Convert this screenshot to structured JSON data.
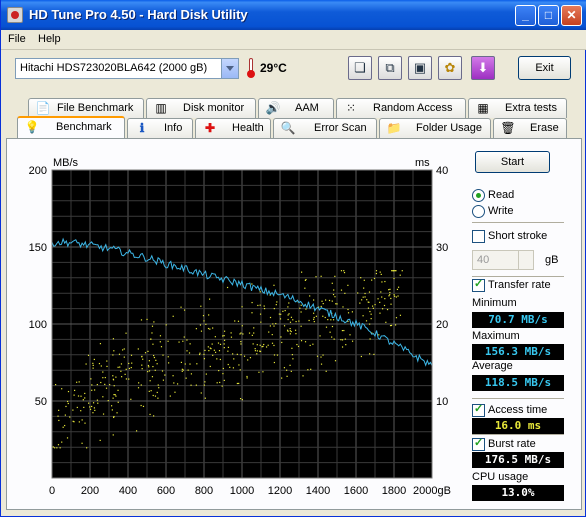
{
  "window": {
    "title": "HD Tune Pro 4.50 - Hard Disk Utility"
  },
  "titlebar_buttons": {
    "minimize": "_",
    "maximize": "□",
    "close": "✕"
  },
  "menu": {
    "file": "File",
    "help": "Help"
  },
  "toolbar": {
    "drive": "Hitachi HDS723020BLA642 (2000 gB)",
    "temperature": "29°C",
    "exit_label": "Exit",
    "icons": [
      "copy-text-icon",
      "copy-screen-icon",
      "save-icon",
      "options-icon",
      "download-icon"
    ]
  },
  "tabs_top": [
    "File Benchmark",
    "Disk monitor",
    "AAM",
    "Random Access",
    "Extra tests"
  ],
  "tabs_bottom": [
    "Benchmark",
    "Info",
    "Health",
    "Error Scan",
    "Folder Usage",
    "Erase"
  ],
  "active_tab": "Benchmark",
  "controls": {
    "start_label": "Start",
    "read_label": "Read",
    "write_label": "Write",
    "mode": "Read",
    "short_stroke_label": "Short stroke",
    "short_stroke_checked": false,
    "short_stroke_value": "40",
    "short_stroke_unit": "gB",
    "transfer_rate_label": "Transfer rate",
    "transfer_rate_checked": true,
    "minimum_label": "Minimum",
    "minimum_value": "70.7 MB/s",
    "maximum_label": "Maximum",
    "maximum_value": "156.3 MB/s",
    "average_label": "Average",
    "average_value": "118.5 MB/s",
    "access_time_label": "Access time",
    "access_time_checked": true,
    "access_time_value": "16.0 ms",
    "burst_rate_label": "Burst rate",
    "burst_rate_checked": true,
    "burst_rate_value": "176.5 MB/s",
    "cpu_label": "CPU usage",
    "cpu_value": "13.0%"
  },
  "colors": {
    "transfer_line": "#3db6e6",
    "access_dots": "#e8e83a",
    "plot_bg": "#000000",
    "value_cyan": "#38c8f0",
    "value_yellow": "#e8e83a",
    "value_white": "#ffffff"
  },
  "chart_data": {
    "type": "line",
    "y_left_label": "MB/s",
    "y_right_label": "ms",
    "x_unit": "gB",
    "xlim": [
      0,
      2000
    ],
    "ylim_left": [
      0,
      200
    ],
    "ylim_right": [
      0,
      40
    ],
    "x_ticks": [
      "0",
      "200",
      "400",
      "600",
      "800",
      "1000",
      "1200",
      "1400",
      "1600",
      "1800",
      "2000gB"
    ],
    "y_left_ticks": [
      "50",
      "100",
      "150",
      "200"
    ],
    "y_right_ticks": [
      "10",
      "20",
      "30",
      "40"
    ],
    "grid": true,
    "series": [
      {
        "kind": "transfer-rate",
        "x": [
          0,
          100,
          200,
          300,
          400,
          500,
          600,
          700,
          800,
          900,
          1000,
          1100,
          1200,
          1300,
          1400,
          1500,
          1600,
          1700,
          1800,
          1900,
          2000
        ],
        "y": [
          153,
          153,
          151,
          149,
          146,
          143,
          139,
          136,
          132,
          129,
          126,
          122,
          119,
          115,
          110,
          105,
          100,
          94,
          87,
          80,
          73
        ]
      },
      {
        "kind": "access-time-scatter",
        "x_range": [
          0,
          1850
        ],
        "ms_min": 4.0,
        "ms_max": 27.0,
        "trend_ms": [
          [
            0,
            7
          ],
          [
            200,
            11
          ],
          [
            400,
            13
          ],
          [
            600,
            15
          ],
          [
            800,
            17
          ],
          [
            1000,
            18
          ],
          [
            1200,
            19
          ],
          [
            1400,
            21
          ],
          [
            1600,
            22
          ],
          [
            1800,
            24
          ]
        ]
      }
    ]
  }
}
